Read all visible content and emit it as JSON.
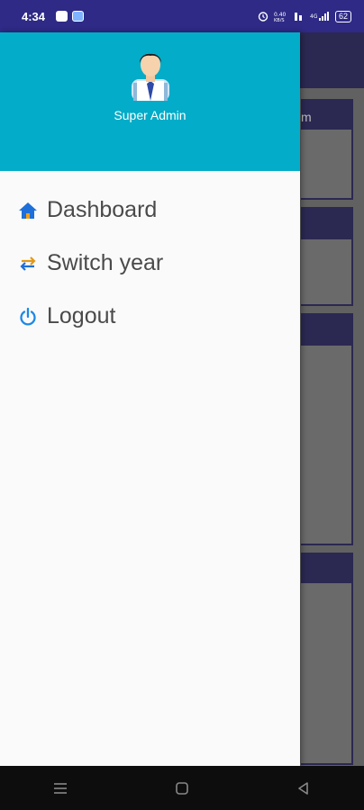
{
  "status_bar": {
    "time": "4:34",
    "battery": "62",
    "network_text": "0.40\nKB/S"
  },
  "drawer": {
    "user_name": "Super Admin",
    "header_color": "#03acc8",
    "menu": [
      {
        "label": "Dashboard",
        "icon": "home-icon",
        "color": "#1e6fd9"
      },
      {
        "label": "Switch year",
        "icon": "swap-icon",
        "color": "#e09a1b"
      },
      {
        "label": "Logout",
        "icon": "power-icon",
        "color": "#1e88e5"
      }
    ]
  },
  "background_page": {
    "partial_text": "m"
  },
  "nav_bar": {
    "buttons": [
      "menu-icon",
      "home-square-icon",
      "back-triangle-icon"
    ]
  }
}
